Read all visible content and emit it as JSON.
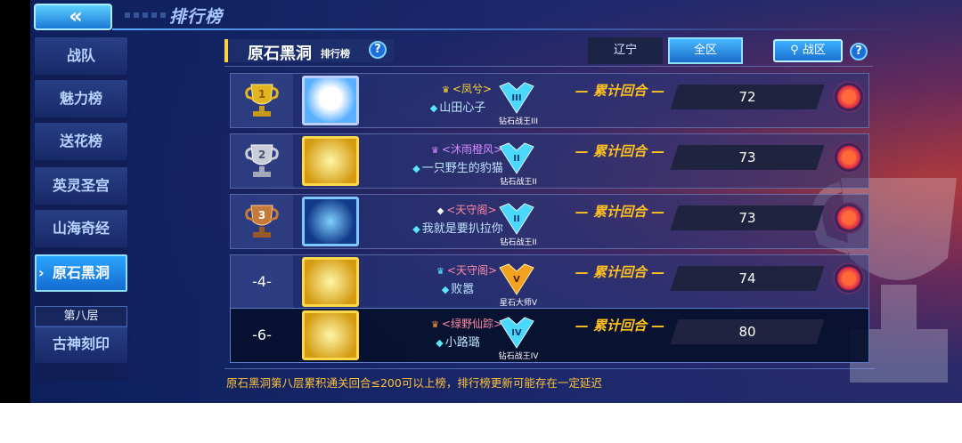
{
  "header": {
    "back_icon": "«",
    "title": "排行榜"
  },
  "sidebar": {
    "items": [
      {
        "label": "战队"
      },
      {
        "label": "魅力榜"
      },
      {
        "label": "送花榜"
      },
      {
        "label": "英灵圣宫"
      },
      {
        "label": "山海奇经"
      },
      {
        "label": "原石黑洞",
        "active": true
      },
      {
        "label": "古神刻印"
      }
    ],
    "sub_item": "第八层"
  },
  "panel": {
    "title": "原石黑洞",
    "subtitle": "排行榜",
    "help": "?",
    "tabs": [
      {
        "label": "辽宁"
      },
      {
        "label": "全区",
        "selected": true
      }
    ],
    "zone_button": {
      "icon": "location-pin-icon",
      "label": "战区"
    }
  },
  "rows": [
    {
      "rank": "1",
      "rank_display": "",
      "avatar_style": "white",
      "team": "<凤兮>",
      "team_color": "#ffd23a",
      "player": "山田心子",
      "badge": "钻石战王III",
      "score_label": "累计回合",
      "score": "72",
      "flower": true
    },
    {
      "rank": "2",
      "rank_display": "",
      "avatar_style": "gold",
      "team": "<沐雨橙风>",
      "team_color": "#d68cff",
      "player": "一只野生的豹猫",
      "badge": "钻石战王II",
      "score_label": "累计回合",
      "score": "73",
      "flower": true
    },
    {
      "rank": "3",
      "rank_display": "",
      "avatar_style": "blue",
      "team": "<天守阁>",
      "team_color": "#ff8aa8",
      "player": "我就是要扒拉你",
      "badge": "钻石战王II",
      "score_label": "累计回合",
      "score": "73",
      "flower": true
    },
    {
      "rank": "4",
      "rank_display": "-4-",
      "avatar_style": "gold",
      "team": "<天守阁>",
      "team_color": "#ff8aa8",
      "player": "败嚣",
      "badge": "星石大师V",
      "score_label": "累计回合",
      "score": "74",
      "flower": true
    },
    {
      "rank": "6",
      "rank_display": "-6-",
      "avatar_style": "gold",
      "team": "<绿野仙踪>",
      "team_color": "#ff8aa8",
      "player": "小路璐",
      "badge": "钻石战王IV",
      "score_label": "累计回合",
      "score": "80",
      "flower": false,
      "mine": true
    }
  ],
  "notice": "原石黑洞第八层累积通关回合≤200可以上榜，排行榜更新可能存在一定延迟",
  "colors": {
    "accent": "#ffc21e",
    "tab_selected": "#1c6cc8",
    "gold": "#e2b420",
    "silver": "#c9cdd8",
    "bronze": "#c67a3a"
  }
}
